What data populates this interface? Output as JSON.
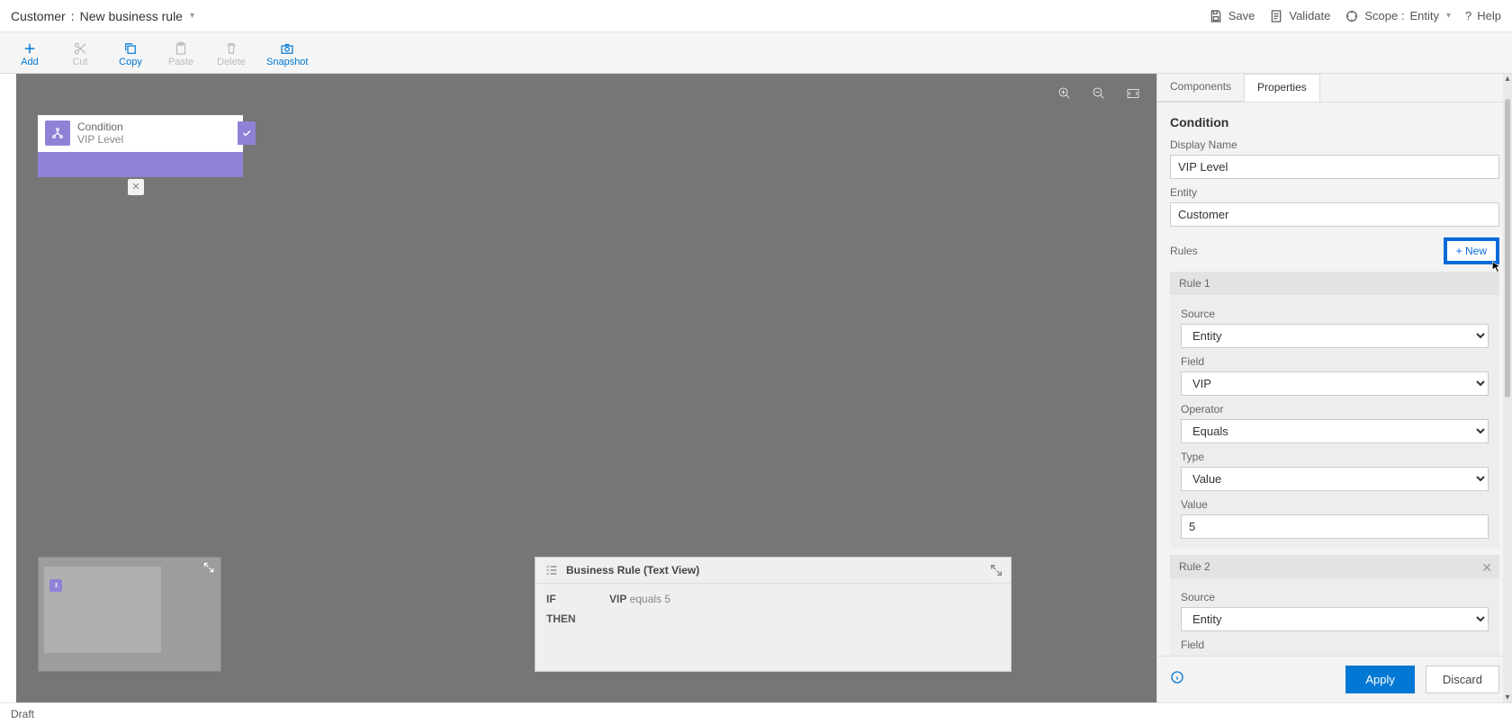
{
  "header": {
    "entity": "Customer",
    "separator": ":",
    "rule_name": "New business rule",
    "save": "Save",
    "validate": "Validate",
    "scope_label": "Scope :",
    "scope_value": "Entity",
    "help": "Help"
  },
  "toolbar": {
    "add": "Add",
    "cut": "Cut",
    "copy": "Copy",
    "paste": "Paste",
    "delete": "Delete",
    "snapshot": "Snapshot"
  },
  "canvas": {
    "condition": {
      "title": "Condition",
      "subtitle": "VIP Level"
    },
    "textview": {
      "title": "Business Rule (Text View)",
      "if": "IF",
      "then": "THEN",
      "field": "VIP",
      "rest": "equals 5"
    }
  },
  "panel": {
    "tabs": {
      "components": "Components",
      "properties": "Properties"
    },
    "section": "Condition",
    "display_name_lbl": "Display Name",
    "display_name_val": "VIP Level",
    "entity_lbl": "Entity",
    "entity_val": "Customer",
    "rules_lbl": "Rules",
    "new_btn": "+ New",
    "rule1": {
      "title": "Rule 1",
      "source_lbl": "Source",
      "source_val": "Entity",
      "field_lbl": "Field",
      "field_val": "VIP",
      "operator_lbl": "Operator",
      "operator_val": "Equals",
      "type_lbl": "Type",
      "type_val": "Value",
      "value_lbl": "Value",
      "value_val": "5"
    },
    "rule2": {
      "title": "Rule 2",
      "source_lbl": "Source",
      "source_val": "Entity",
      "field_lbl": "Field"
    },
    "apply": "Apply",
    "discard": "Discard"
  },
  "status": {
    "text": "Draft"
  }
}
